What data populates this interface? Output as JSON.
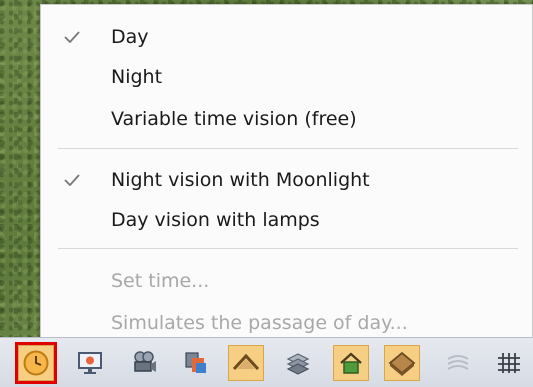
{
  "menu": {
    "items": [
      {
        "label": "Day",
        "checked": true,
        "enabled": true
      },
      {
        "label": "Night",
        "checked": false,
        "enabled": true
      },
      {
        "label": "Variable time vision (free)",
        "checked": false,
        "enabled": true
      },
      {
        "label": "Night vision with Moonlight",
        "checked": true,
        "enabled": true
      },
      {
        "label": "Day vision with lamps",
        "checked": false,
        "enabled": true
      },
      {
        "label": "Set time...",
        "checked": false,
        "enabled": false
      },
      {
        "label": "Simulates the passage of day...",
        "checked": false,
        "enabled": false
      }
    ]
  },
  "toolbar": {
    "buttons": [
      {
        "icon": "clock-icon",
        "state": "highlighted"
      },
      {
        "icon": "monitor-icon",
        "state": "normal"
      },
      {
        "icon": "camera-icon",
        "state": "normal"
      },
      {
        "icon": "layers-icon",
        "state": "normal"
      },
      {
        "icon": "roof-icon",
        "state": "toggled"
      },
      {
        "icon": "walls-icon",
        "state": "normal"
      },
      {
        "icon": "house-icon",
        "state": "toggled"
      },
      {
        "icon": "floor-icon",
        "state": "toggled"
      },
      {
        "icon": "ripple-icon",
        "state": "disabled"
      },
      {
        "icon": "grid-icon",
        "state": "normal"
      }
    ]
  },
  "colors": {
    "highlight_border": "#e00000",
    "toggled_bg": "#f6cf85",
    "disabled_text": "#a8a8a8",
    "menu_bg": "#fbfbfb"
  }
}
